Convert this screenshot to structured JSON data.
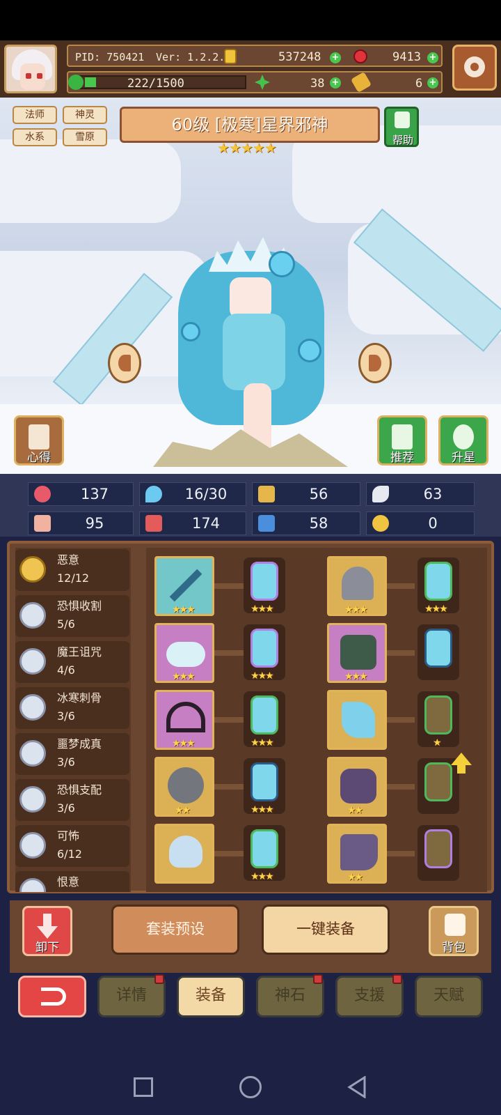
{
  "header": {
    "pid": "PID: 750421",
    "version": "Ver: 1.2.2.2",
    "gold": "537248",
    "gems": "9413",
    "exp": "222/1500",
    "clover": "38",
    "key": "6"
  },
  "hero": {
    "tags": [
      "法师",
      "神灵",
      "水系",
      "雪原"
    ],
    "title": "60级 [极寒]星界邪神",
    "stars": "★★★★★",
    "help_label": "帮助",
    "experience_label": "心得",
    "recommend_label": "推荐",
    "upstar_label": "升星"
  },
  "stats": [
    "137",
    "16/30",
    "56",
    "63",
    "95",
    "174",
    "58",
    "0"
  ],
  "sets": [
    {
      "name": "恶意",
      "count": "12/12"
    },
    {
      "name": "恐惧收割",
      "count": "5/6"
    },
    {
      "name": "魔王诅咒",
      "count": "4/6"
    },
    {
      "name": "冰寒刺骨",
      "count": "3/6"
    },
    {
      "name": "噩梦成真",
      "count": "3/6"
    },
    {
      "name": "恐惧支配",
      "count": "3/6"
    },
    {
      "name": "可怖",
      "count": "6/12"
    },
    {
      "name": "恨意",
      "count": ""
    }
  ],
  "equip_stars": {
    "r1a": "★★★",
    "r1b": "★★★",
    "r1c": "★★★",
    "r1d": "★★★",
    "r2a": "★★★",
    "r2b": "★★★",
    "r2c": "★★★",
    "r3a": "★★★",
    "r3b": "★★★",
    "r3c": "★",
    "r4a": "★★",
    "r4b": "★★★",
    "r4c": "★★",
    "r5b": "★★★",
    "r5c": "★★"
  },
  "actions": {
    "unequip": "卸下",
    "preset": "套装预设",
    "auto_equip": "一键装备",
    "bag": "背包"
  },
  "tabs": [
    "详情",
    "装备",
    "神石",
    "支援",
    "天赋"
  ],
  "colors": {
    "accent_red": "#e04848",
    "panel_brown": "#6a4530",
    "tab_active": "#f3d9a6"
  }
}
